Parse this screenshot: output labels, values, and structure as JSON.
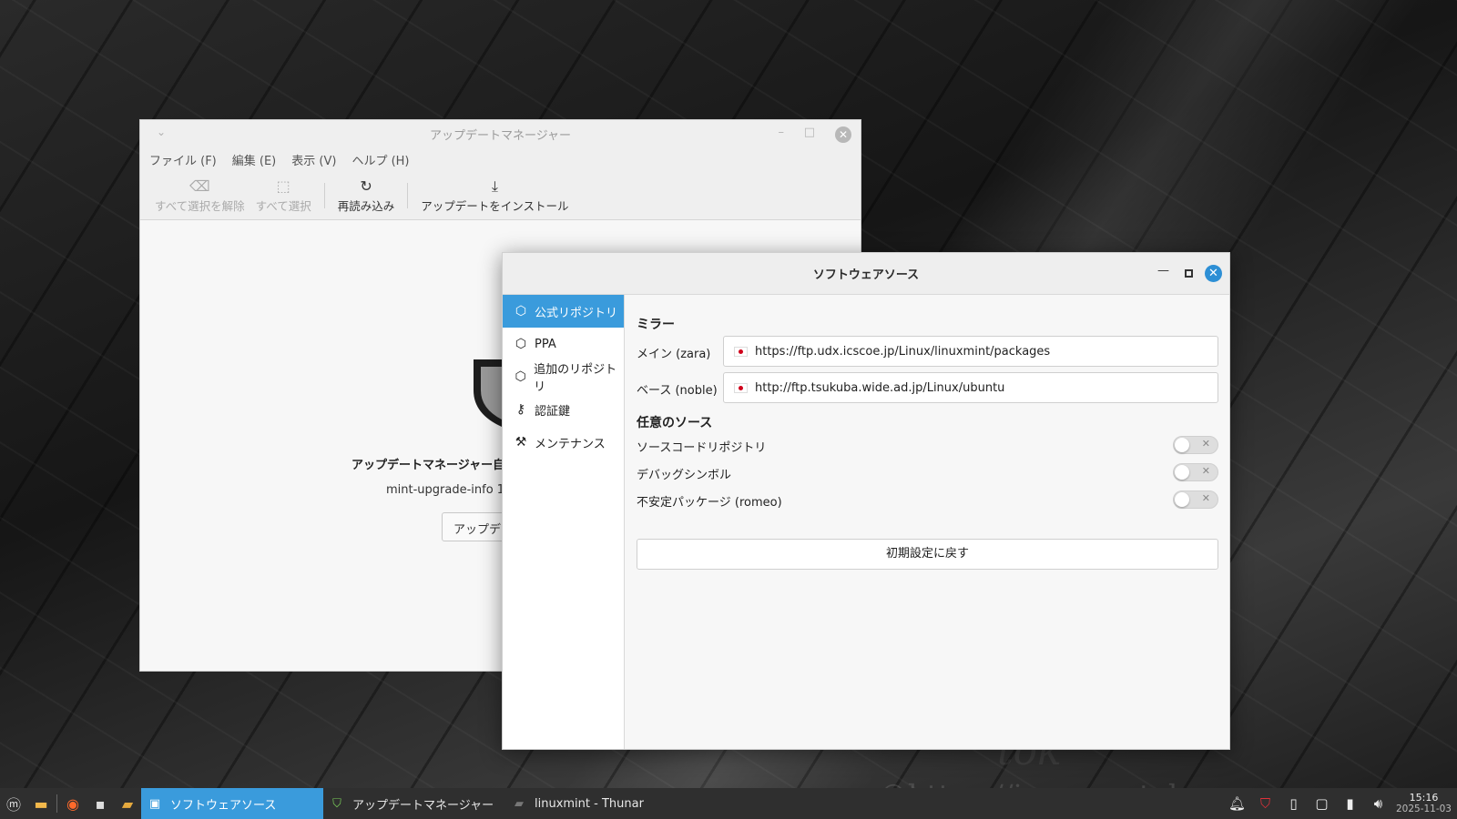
{
  "desktop": {
    "watermark": "©https://impress.tokyo",
    "watermark_big": "tok"
  },
  "update_manager": {
    "title": "アップデートマネージャー",
    "menu": [
      "ファイル (F)",
      "編集 (E)",
      "表示 (V)",
      "ヘルプ (H)"
    ],
    "toolbar": {
      "clear_selection": "すべて選択を解除",
      "select_all": "すべて選択",
      "refresh": "再読み込み",
      "install": "アップデートをインストール"
    },
    "body": {
      "heading": "アップデートマネージャー自体",
      "sub": "mint-upgrade-info 1.2",
      "button": "アップデー"
    }
  },
  "software_sources": {
    "title": "ソフトウェアソース",
    "sidebar": [
      {
        "label": "公式リポジトリ",
        "icon": "package-icon",
        "active": true
      },
      {
        "label": "PPA",
        "icon": "package-icon",
        "active": false
      },
      {
        "label": "追加のリポジトリ",
        "icon": "package-icon",
        "active": false
      },
      {
        "label": "認証鍵",
        "icon": "key-icon",
        "active": false
      },
      {
        "label": "メンテナンス",
        "icon": "wrench-icon",
        "active": false
      }
    ],
    "mirrors": {
      "title": "ミラー",
      "main_label": "メイン (zara)",
      "main_url": "https://ftp.udx.icscoe.jp/Linux/linuxmint/packages",
      "base_label": "ベース (noble)",
      "base_url": "http://ftp.tsukuba.wide.ad.jp/Linux/ubuntu"
    },
    "optional": {
      "title": "任意のソース",
      "items": [
        {
          "label": "ソースコードリポジトリ",
          "enabled": false
        },
        {
          "label": "デバッグシンボル",
          "enabled": false
        },
        {
          "label": "不安定パッケージ (romeo)",
          "enabled": false
        }
      ]
    },
    "reset_button": "初期設定に戻す"
  },
  "taskbar": {
    "tasks": [
      {
        "label": "ソフトウェアソース",
        "active": true
      },
      {
        "label": "アップデートマネージャー",
        "active": false
      },
      {
        "label": "linuxmint - Thunar",
        "active": false
      }
    ],
    "time": "15:16",
    "date": "2025-11-03"
  },
  "colors": {
    "accent": "#3a9bdc",
    "flag_red": "#d0021b"
  }
}
